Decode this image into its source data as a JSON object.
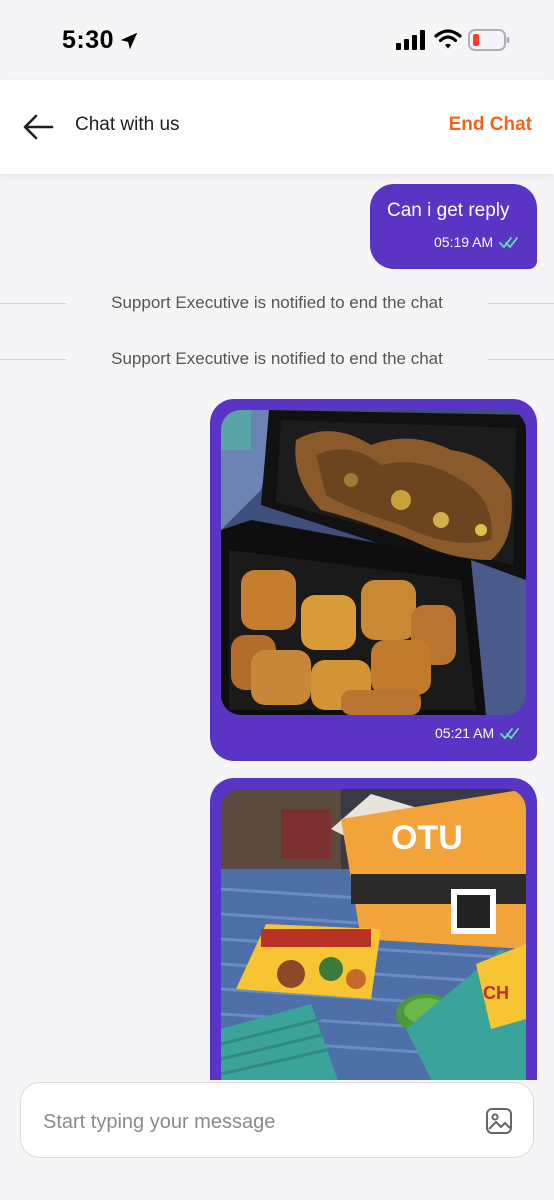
{
  "status_bar": {
    "time": "5:30"
  },
  "header": {
    "title": "Chat with us",
    "end_chat_label": "End Chat"
  },
  "messages": [
    {
      "type": "text",
      "text": "Can i get reply",
      "time": "05:19 AM"
    },
    {
      "type": "system",
      "text": "Support Executive is notified to end the chat"
    },
    {
      "type": "system",
      "text": "Support Executive is notified to end the chat"
    },
    {
      "type": "image",
      "time": "05:21 AM"
    },
    {
      "type": "image"
    }
  ],
  "composer": {
    "placeholder": "Start typing your message"
  },
  "colors": {
    "bubble": "#5a34c4",
    "accent": "#f0641e",
    "read_check": "#5ee0b0"
  }
}
